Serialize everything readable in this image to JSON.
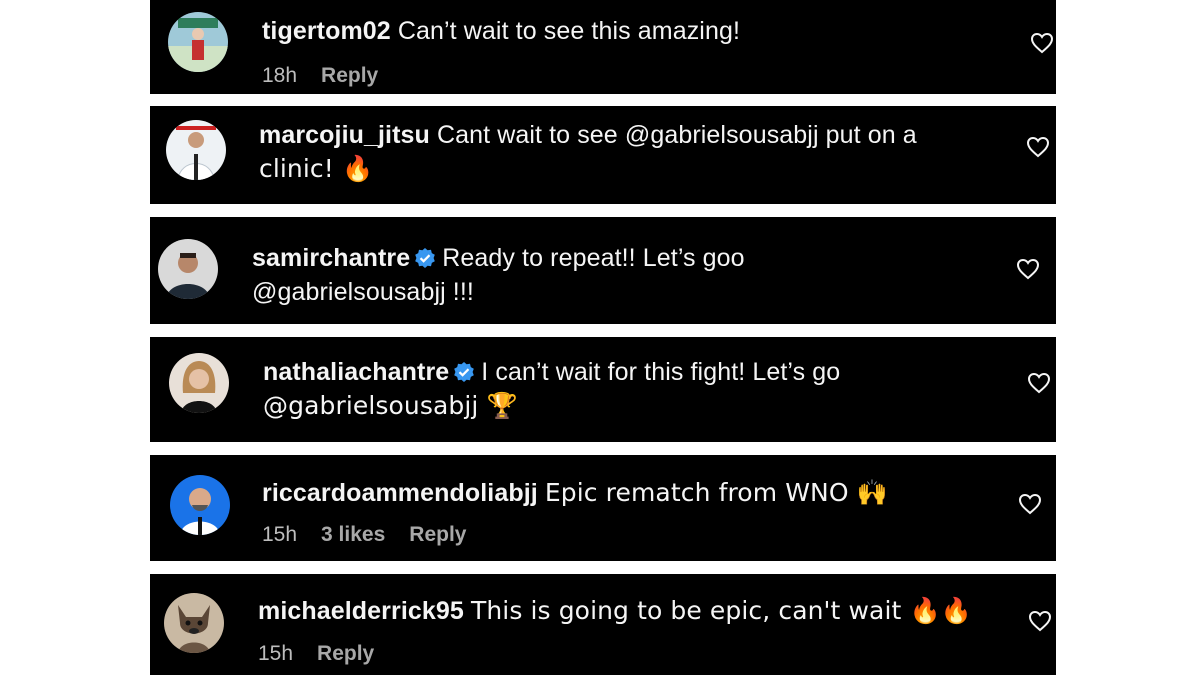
{
  "comments": [
    {
      "username": "tigertom02",
      "verified": false,
      "text": "Can’t wait to see this amazing!",
      "time": "18h",
      "likes": "",
      "reply": "Reply"
    },
    {
      "username": "marcojiu_jitsu",
      "verified": false,
      "text": "Cant wait to see @gabrielsousabjj put on a",
      "text_line2": "clinic! 🔥",
      "time": "",
      "likes": "",
      "reply": ""
    },
    {
      "username": "samirchantre",
      "verified": true,
      "text": "Ready to repeat!! Let’s goo",
      "text_line2": "@gabrielsousabjj !!!",
      "time": "",
      "likes": "",
      "reply": ""
    },
    {
      "username": "nathaliachantre",
      "verified": true,
      "text": "I can’t wait for this fight! Let’s go",
      "text_line2": "@gabrielsousabjj 🏆",
      "time": "",
      "likes": "",
      "reply": ""
    },
    {
      "username": "riccardoammendoliabjj",
      "verified": false,
      "text": "Epic rematch from WNO 🙌",
      "time": "15h",
      "likes": "3 likes",
      "reply": "Reply"
    },
    {
      "username": "michaelderrick95",
      "verified": false,
      "text": "This is going to be epic, can't wait 🔥🔥",
      "time": "15h",
      "likes": "",
      "reply": "Reply"
    }
  ],
  "icons": {
    "like": "heart-outline-icon",
    "verified": "verified-badge-icon"
  },
  "colors": {
    "card_bg": "#000000",
    "text": "#f5f5f5",
    "meta": "#a8a8a8",
    "verified": "#3897f0"
  }
}
